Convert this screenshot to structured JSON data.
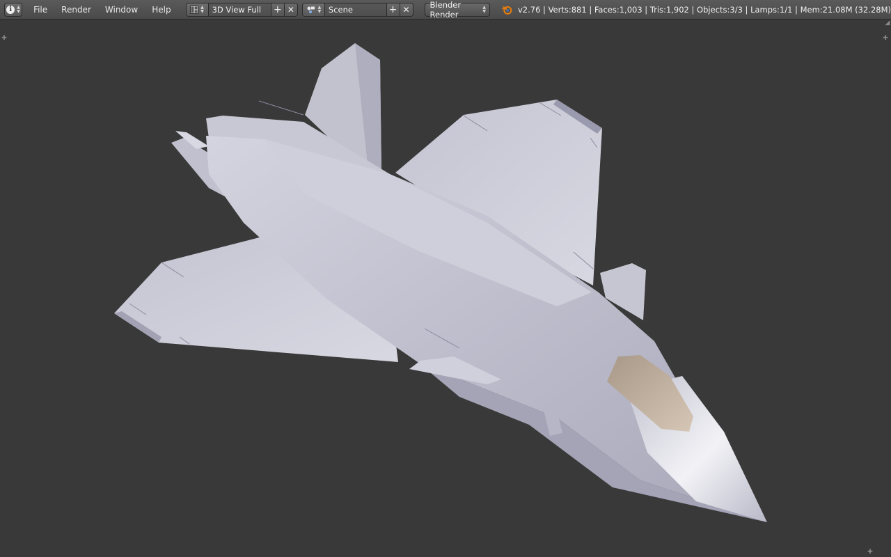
{
  "topbar": {
    "menus": [
      "File",
      "Render",
      "Window",
      "Help"
    ],
    "screen_layout": "3D View Full",
    "scene": "Scene",
    "render_engine": "Blender Render",
    "stats": "v2.76 | Verts:881 | Faces:1,003 | Tris:1,902 | Objects:3/3 | Lamps:1/1 | Mem:21.08M (32.28M)"
  },
  "icons": {
    "editor_type": "info-icon",
    "screen": "screen-layout-icon",
    "scene": "scene-icon",
    "blender": "blender-logo-icon",
    "add": "plus-icon",
    "remove": "close-icon"
  },
  "colors": {
    "header_bg": "#4f4f4f",
    "viewport_bg": "#393939",
    "model": "#c9c9d6",
    "canopy": "#b8a898"
  }
}
